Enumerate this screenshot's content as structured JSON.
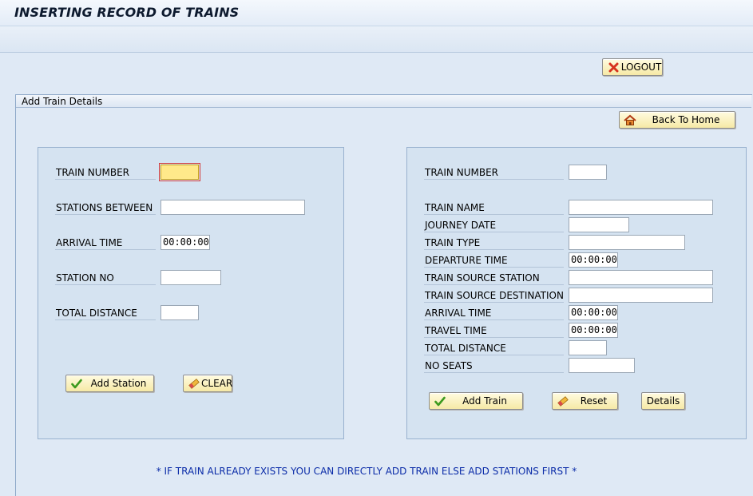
{
  "header": {
    "title": "INSERTING RECORD OF TRAINS"
  },
  "actions": {
    "logout_label": "LOGOUT",
    "back_home_label": "Back To Home"
  },
  "group": {
    "title": "Add Train Details"
  },
  "left_form": {
    "train_number_label": "TRAIN NUMBER",
    "train_number_value": "",
    "stations_between_label": "STATIONS BETWEEN",
    "stations_between_value": "",
    "arrival_time_label": "ARRIVAL TIME",
    "arrival_time_value": "00:00:00",
    "station_no_label": "STATION NO",
    "station_no_value": "",
    "total_distance_label": "TOTAL DISTANCE",
    "total_distance_value": "",
    "add_station_label": "Add Station",
    "clear_label": "CLEAR"
  },
  "right_form": {
    "train_number_label": "TRAIN NUMBER",
    "train_number_value": "",
    "train_name_label": "TRAIN NAME",
    "train_name_value": "",
    "journey_date_label": "JOURNEY DATE",
    "journey_date_value": "",
    "train_type_label": "TRAIN TYPE",
    "train_type_value": "",
    "departure_time_label": "DEPARTURE TIME",
    "departure_time_value": "00:00:00",
    "source_station_label": "TRAIN SOURCE STATION",
    "source_station_value": "",
    "source_destination_label": "TRAIN SOURCE DESTINATION",
    "source_destination_value": "",
    "arrival_time_label": "ARRIVAL TIME",
    "arrival_time_value": "00:00:00",
    "travel_time_label": "TRAVEL TIME",
    "travel_time_value": "00:00:00",
    "total_distance_label": "TOTAL DISTANCE",
    "total_distance_value": "",
    "no_seats_label": "NO SEATS",
    "no_seats_value": "",
    "add_train_label": "Add Train",
    "reset_label": "Reset",
    "details_label": "Details"
  },
  "note": "* IF TRAIN ALREADY EXISTS YOU CAN DIRECTLY ADD TRAIN ELSE ADD STATIONS FIRST *",
  "icons": {
    "logout": "close-x-icon",
    "back_home": "home-icon",
    "add": "checkmark-icon",
    "clear": "eraser-icon"
  },
  "colors": {
    "background": "#dfe9f5",
    "button": "#f6e9a6",
    "focus_field": "#ffe98a",
    "note": "#0b2ca8"
  }
}
